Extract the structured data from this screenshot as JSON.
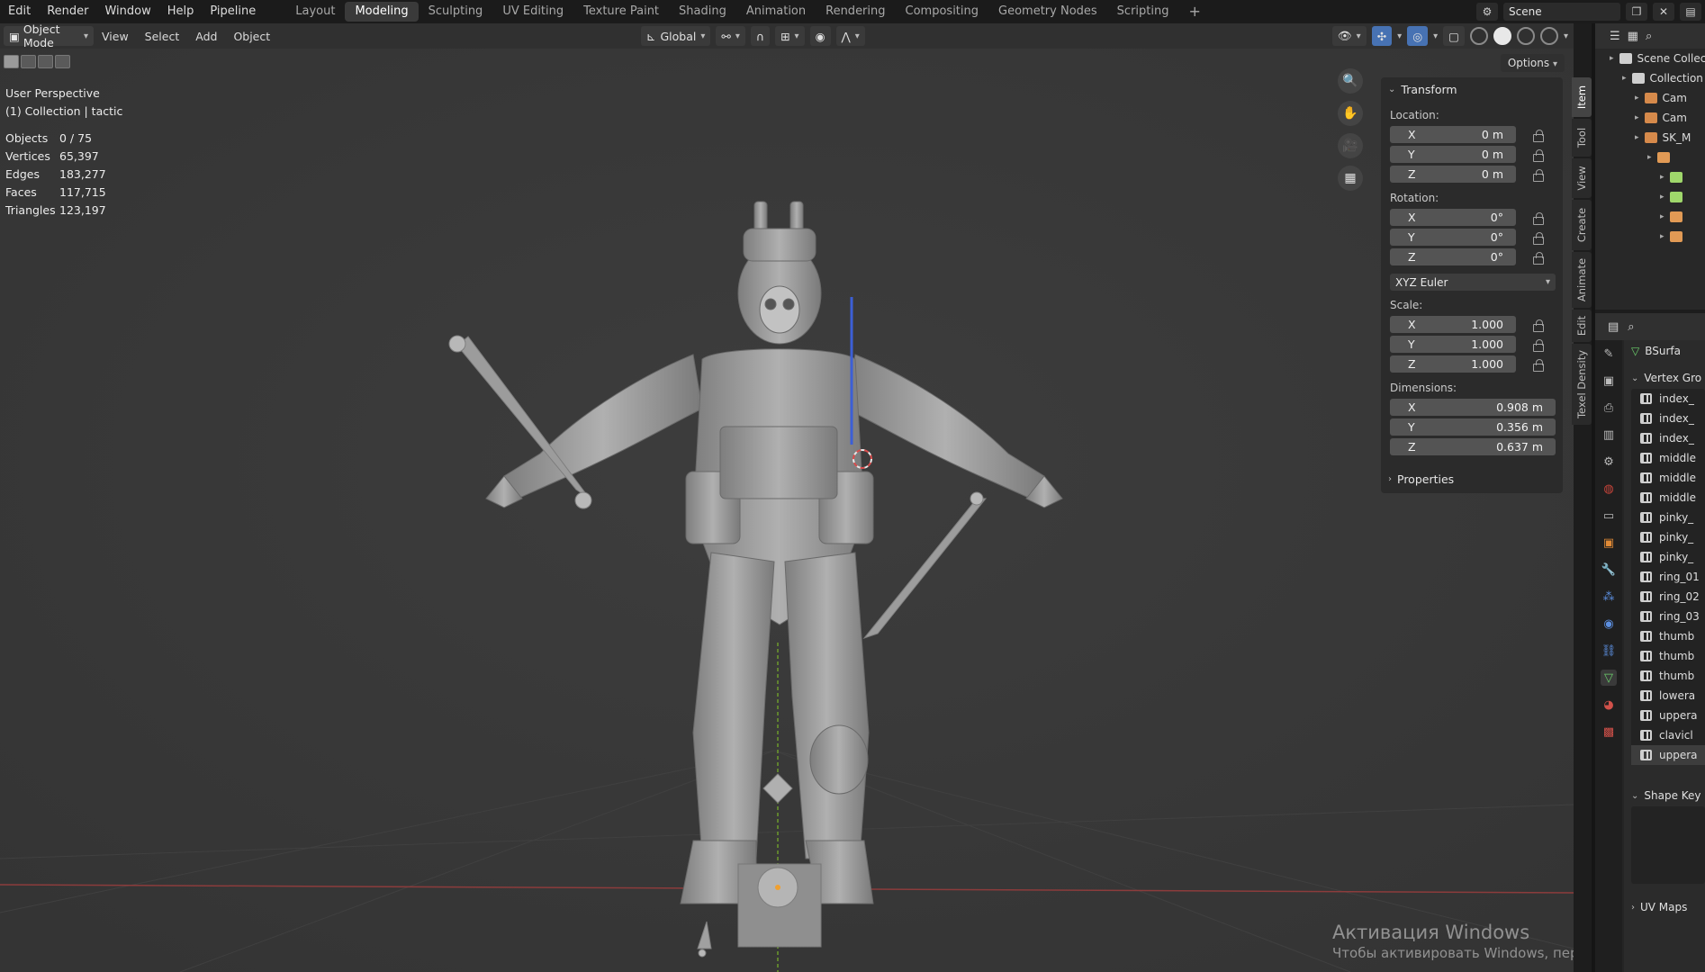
{
  "menu": [
    "Edit",
    "Render",
    "Window",
    "Help",
    "Pipeline"
  ],
  "workspaces": [
    {
      "label": "Layout",
      "active": false
    },
    {
      "label": "Modeling",
      "active": true
    },
    {
      "label": "Sculpting",
      "active": false
    },
    {
      "label": "UV Editing",
      "active": false
    },
    {
      "label": "Texture Paint",
      "active": false
    },
    {
      "label": "Shading",
      "active": false
    },
    {
      "label": "Animation",
      "active": false
    },
    {
      "label": "Rendering",
      "active": false
    },
    {
      "label": "Compositing",
      "active": false
    },
    {
      "label": "Geometry Nodes",
      "active": false
    },
    {
      "label": "Scripting",
      "active": false
    }
  ],
  "add_workspace": "+",
  "scene": {
    "name": "Scene"
  },
  "header": {
    "mode": "Object Mode",
    "menus": [
      "View",
      "Select",
      "Add",
      "Object"
    ],
    "transform_orientation": "Global",
    "options": "Options"
  },
  "viewport": {
    "perspective": "User Perspective",
    "collection": "(1) Collection | tactic",
    "stats": [
      {
        "label": "Objects",
        "value": "0 / 75"
      },
      {
        "label": "Vertices",
        "value": "65,397"
      },
      {
        "label": "Edges",
        "value": "183,277"
      },
      {
        "label": "Faces",
        "value": "117,715"
      },
      {
        "label": "Triangles",
        "value": "123,197"
      }
    ]
  },
  "transform": {
    "title": "Transform",
    "location_label": "Location:",
    "location": [
      {
        "axis": "X",
        "value": "0 m"
      },
      {
        "axis": "Y",
        "value": "0 m"
      },
      {
        "axis": "Z",
        "value": "0 m"
      }
    ],
    "rotation_label": "Rotation:",
    "rotation": [
      {
        "axis": "X",
        "value": "0°"
      },
      {
        "axis": "Y",
        "value": "0°"
      },
      {
        "axis": "Z",
        "value": "0°"
      }
    ],
    "rotation_mode": "XYZ Euler",
    "scale_label": "Scale:",
    "scale": [
      {
        "axis": "X",
        "value": "1.000"
      },
      {
        "axis": "Y",
        "value": "1.000"
      },
      {
        "axis": "Z",
        "value": "1.000"
      }
    ],
    "dimensions_label": "Dimensions:",
    "dimensions": [
      {
        "axis": "X",
        "value": "0.908 m"
      },
      {
        "axis": "Y",
        "value": "0.356 m"
      },
      {
        "axis": "Z",
        "value": "0.637 m"
      }
    ],
    "properties": "Properties"
  },
  "sidebar_tabs": [
    {
      "label": "Item",
      "active": true
    },
    {
      "label": "Tool",
      "active": false
    },
    {
      "label": "View",
      "active": false
    },
    {
      "label": "Create",
      "active": false
    },
    {
      "label": "Animate",
      "active": false
    },
    {
      "label": "Edit",
      "active": false
    },
    {
      "label": "Texel Density",
      "active": false
    }
  ],
  "outliner": {
    "rows": [
      {
        "label": "Scene Collec",
        "indent": 0,
        "color": "#cfcfcf"
      },
      {
        "label": "Collection",
        "indent": 1,
        "color": "#cfcfcf"
      },
      {
        "label": "Cam",
        "indent": 2,
        "color": "#d68a4b"
      },
      {
        "label": "Cam",
        "indent": 2,
        "color": "#d68a4b"
      },
      {
        "label": "SK_M",
        "indent": 2,
        "color": "#d68a4b"
      },
      {
        "label": "",
        "indent": 3,
        "color": "#e19a55"
      },
      {
        "label": "",
        "indent": 4,
        "color": "#9fd76b"
      },
      {
        "label": "",
        "indent": 4,
        "color": "#9fd76b"
      },
      {
        "label": "",
        "indent": 4,
        "color": "#e19a55"
      },
      {
        "label": "",
        "indent": 4,
        "color": "#e19a55"
      }
    ]
  },
  "properties_panel": {
    "data_name": "BSurfa",
    "vertex_groups_title": "Vertex Gro",
    "vertex_groups": [
      "index_",
      "index_",
      "index_",
      "middle",
      "middle",
      "middle",
      "pinky_",
      "pinky_",
      "pinky_",
      "ring_01",
      "ring_02",
      "ring_03",
      "thumb",
      "thumb",
      "thumb",
      "lowera",
      "uppera",
      "clavicl",
      "uppera"
    ],
    "shape_keys_title": "Shape Key",
    "uv_maps_title": "UV Maps"
  },
  "watermark": {
    "title": "Активация Windows",
    "subtitle": "Чтобы активировать Windows, перейдите в раздел"
  },
  "colors": {
    "viewport_bg": "#393939",
    "x_axis": "#8c3c3c",
    "y_axis": "#6c9a2c",
    "active_tab": "#3a3a3a",
    "bone": "#9c9c9c"
  }
}
